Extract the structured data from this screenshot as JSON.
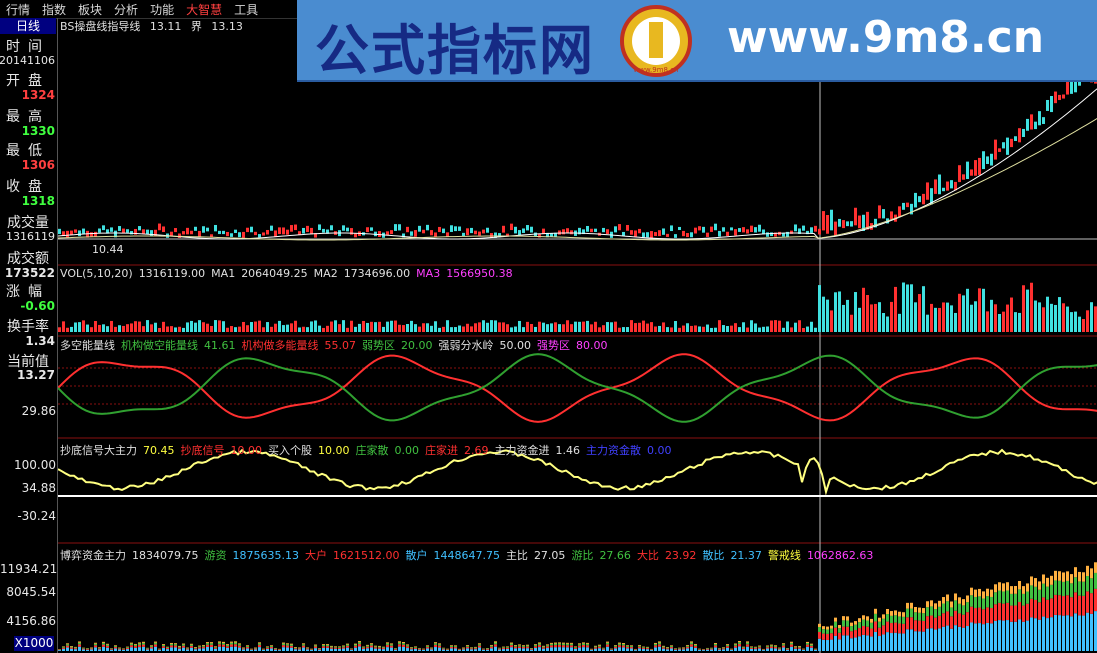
{
  "menu": [
    "行情",
    "指数",
    "板块",
    "分析",
    "功能",
    "大智慧",
    "工具"
  ],
  "left_panel": {
    "tab": "日线",
    "rows": [
      {
        "label": "时间",
        "value": "20141106",
        "color": "#e8e8e8"
      },
      {
        "label": "开盘",
        "value": "1324",
        "color": "#ff4040"
      },
      {
        "label": "最高",
        "value": "1330",
        "color": "#40ff40"
      },
      {
        "label": "最低",
        "value": "1306",
        "color": "#ff4040"
      },
      {
        "label": "收盘",
        "value": "1318",
        "color": "#40ff40"
      },
      {
        "label": "成交量",
        "value": "1316119",
        "color": "#e8e8e8"
      },
      {
        "label": "成交额",
        "value": "173522",
        "color": "#e8e8e8"
      },
      {
        "label": "涨幅",
        "value": "-0.60",
        "color": "#40ff40"
      },
      {
        "label": "换手率",
        "value": "1.34",
        "color": "#e8e8e8"
      },
      {
        "label": "当前值",
        "value": "13.27",
        "color": "#e8e8e8"
      }
    ]
  },
  "watermark": {
    "cn": "公式指标网",
    "url": "www.9m8.cn",
    "logo_text": "www.9m8.cn"
  },
  "main_chart": {
    "title": "BS操盘线指导线",
    "v1": "13.11",
    "label2": "界",
    "v2": "13.13",
    "annotation_high": "10.44"
  },
  "volume": {
    "items": [
      {
        "text": "VOL(5,10,20)",
        "color": "#e0e0e0"
      },
      {
        "text": "1316119.00",
        "color": "#e0e0e0"
      },
      {
        "text": "MA1",
        "color": "#e0e0e0"
      },
      {
        "text": "2064049.25",
        "color": "#e0e0e0"
      },
      {
        "text": "MA2",
        "color": "#e0e0e0"
      },
      {
        "text": "1734696.00",
        "color": "#e0e0e0"
      },
      {
        "text": "MA3",
        "color": "#ff40ff"
      },
      {
        "text": "1566950.38",
        "color": "#ff40ff"
      }
    ]
  },
  "energy": {
    "items": [
      {
        "text": "多空能量线",
        "color": "#e0e0e0"
      },
      {
        "text": "机构做空能量线",
        "color": "#40c040"
      },
      {
        "text": "41.61",
        "color": "#40c040"
      },
      {
        "text": "机构做多能量线",
        "color": "#ff3030"
      },
      {
        "text": "55.07",
        "color": "#ff3030"
      },
      {
        "text": "弱势区",
        "color": "#40c040"
      },
      {
        "text": "20.00",
        "color": "#40c040"
      },
      {
        "text": "强弱分水岭",
        "color": "#e0e0e0"
      },
      {
        "text": "50.00",
        "color": "#e0e0e0"
      },
      {
        "text": "强势区",
        "color": "#ff40ff"
      },
      {
        "text": "80.00",
        "color": "#ff40ff"
      }
    ],
    "axis_label": "29.86"
  },
  "bottom_signal": {
    "items": [
      {
        "text": "抄底信号大主力",
        "color": "#e0e0e0"
      },
      {
        "text": "70.45",
        "color": "#ffff40"
      },
      {
        "text": "抄底信号",
        "color": "#ff3030"
      },
      {
        "text": "10.00",
        "color": "#ff3030"
      },
      {
        "text": "买入个股",
        "color": "#e0e0e0"
      },
      {
        "text": "10.00",
        "color": "#ffff40"
      },
      {
        "text": "庄家散",
        "color": "#40c040"
      },
      {
        "text": "0.00",
        "color": "#40c040"
      },
      {
        "text": "庄家进",
        "color": "#ff3030"
      },
      {
        "text": "2.69",
        "color": "#ff3030"
      },
      {
        "text": "主力资金进",
        "color": "#e0e0e0"
      },
      {
        "text": "1.46",
        "color": "#e0e0e0"
      },
      {
        "text": "主力资金散",
        "color": "#4040ff"
      },
      {
        "text": "0.00",
        "color": "#4040ff"
      }
    ],
    "axis": [
      "100.00",
      "34.88",
      "-30.24"
    ]
  },
  "capital": {
    "items": [
      {
        "text": "博弈资金主力",
        "color": "#e0e0e0"
      },
      {
        "text": "1834079.75",
        "color": "#e0e0e0"
      },
      {
        "text": "游资",
        "color": "#40c040"
      },
      {
        "text": "1875635.13",
        "color": "#40c0ff"
      },
      {
        "text": "大户",
        "color": "#ff3030"
      },
      {
        "text": "1621512.00",
        "color": "#ff3030"
      },
      {
        "text": "散户",
        "color": "#40c0ff"
      },
      {
        "text": "1448647.75",
        "color": "#40c0ff"
      },
      {
        "text": "主比",
        "color": "#e0e0e0"
      },
      {
        "text": "27.05",
        "color": "#e0e0e0"
      },
      {
        "text": "游比",
        "color": "#40c040"
      },
      {
        "text": "27.66",
        "color": "#40c040"
      },
      {
        "text": "大比",
        "color": "#ff3030"
      },
      {
        "text": "23.92",
        "color": "#ff3030"
      },
      {
        "text": "散比",
        "color": "#40c0ff"
      },
      {
        "text": "21.37",
        "color": "#40c0ff"
      },
      {
        "text": "警戒线",
        "color": "#ffff40"
      },
      {
        "text": "1062862.63",
        "color": "#ff40ff"
      }
    ],
    "axis": [
      "11934.21",
      "8045.54",
      "4156.86"
    ],
    "unit": "X1000"
  }
}
